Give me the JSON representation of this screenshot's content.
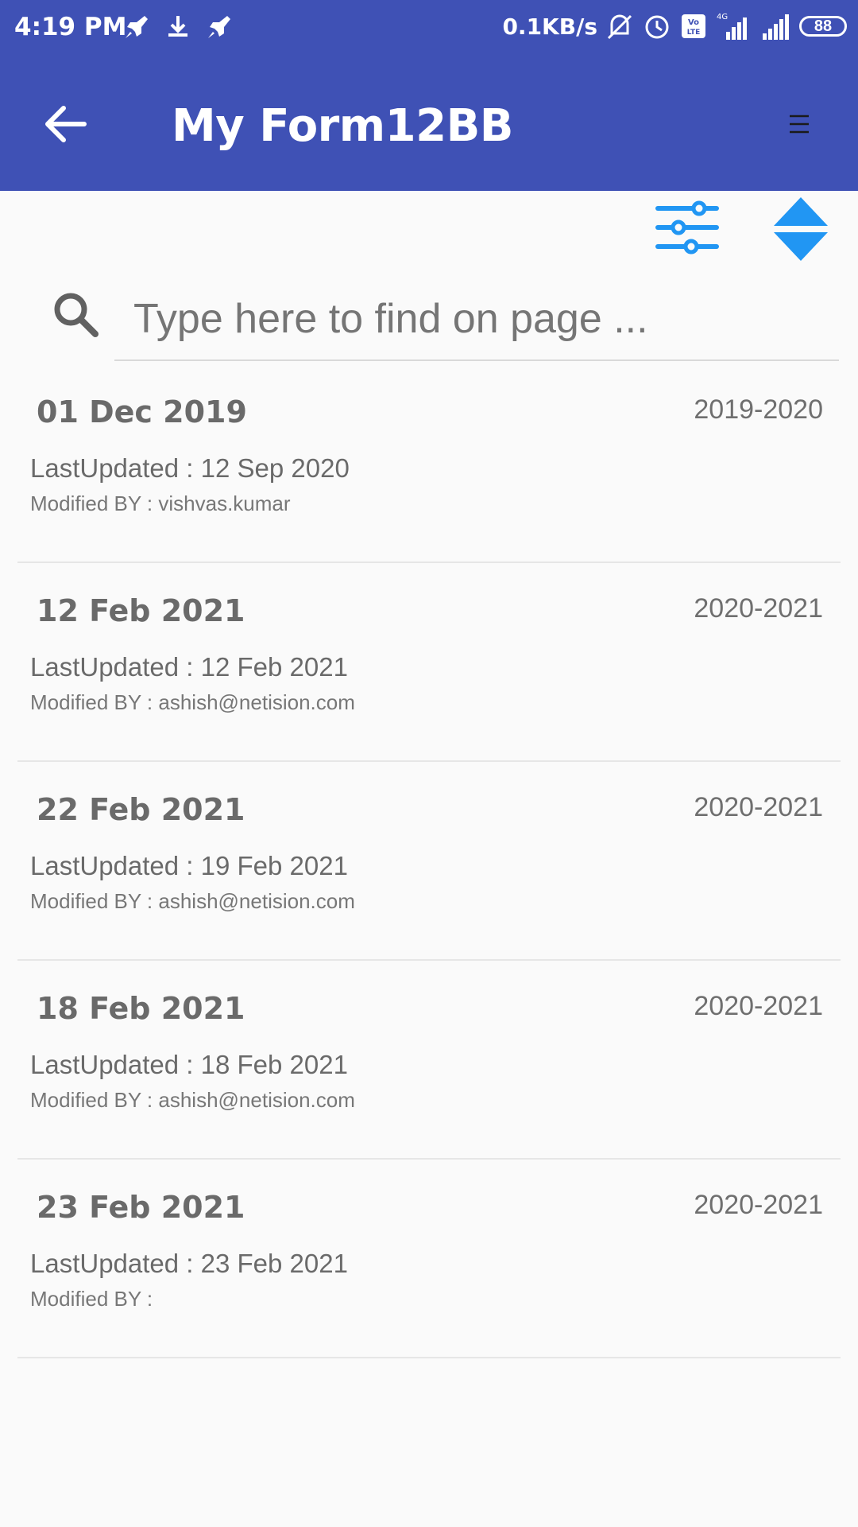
{
  "status_bar": {
    "time": "4:19 PM",
    "network_speed": "0.1KB/s",
    "battery": "88"
  },
  "header": {
    "title": "My Form12BB"
  },
  "search": {
    "placeholder": "Type here to find on page ..."
  },
  "colors": {
    "app_bar": "#3f51b5",
    "accent_icon": "#2196f3",
    "text": "#6b6b6b"
  },
  "items": [
    {
      "date": "01 Dec 2019",
      "year": "2019-2020",
      "updated": "LastUpdated : 12 Sep 2020",
      "modified": "Modified BY : vishvas.kumar"
    },
    {
      "date": "12 Feb 2021",
      "year": "2020-2021",
      "updated": "LastUpdated : 12 Feb 2021",
      "modified": "Modified BY : ashish@netision.com"
    },
    {
      "date": "22 Feb 2021",
      "year": "2020-2021",
      "updated": "LastUpdated : 19 Feb 2021",
      "modified": "Modified BY : ashish@netision.com"
    },
    {
      "date": "18 Feb 2021",
      "year": "2020-2021",
      "updated": "LastUpdated : 18 Feb 2021",
      "modified": "Modified BY : ashish@netision.com"
    },
    {
      "date": "23 Feb 2021",
      "year": "2020-2021",
      "updated": "LastUpdated : 23 Feb 2021",
      "modified": "Modified BY :"
    }
  ]
}
